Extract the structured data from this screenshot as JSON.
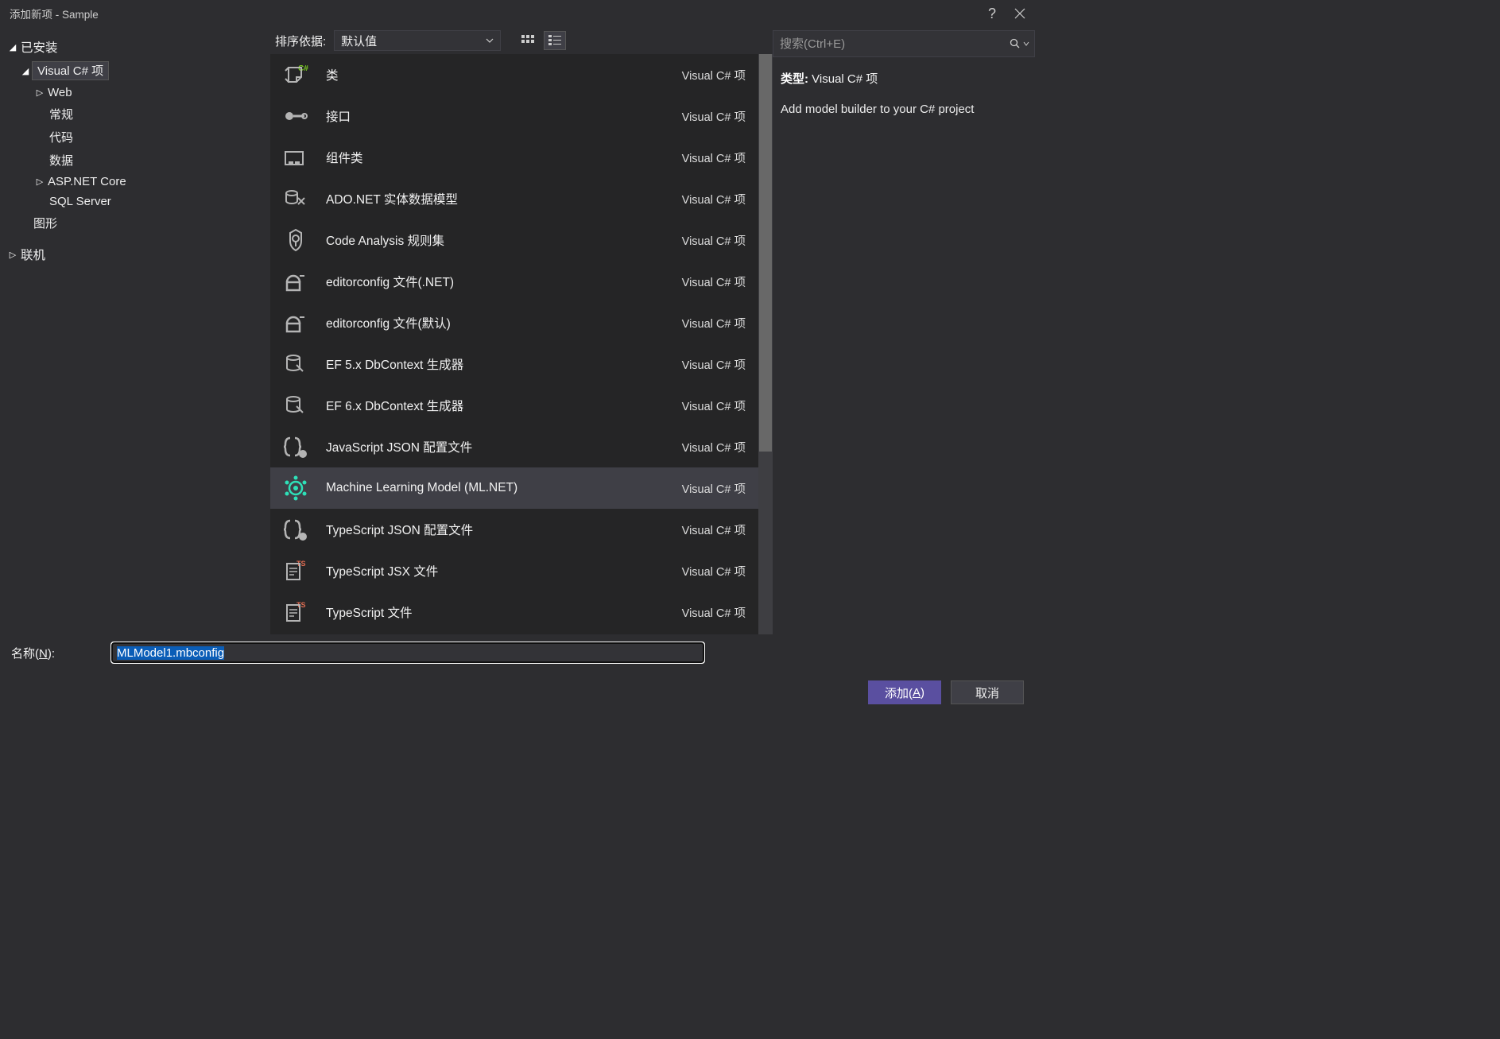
{
  "title": "添加新项 - Sample",
  "tree": {
    "installed": "已安装",
    "csharp": "Visual C# 项",
    "web": "Web",
    "general": "常规",
    "code": "代码",
    "data": "数据",
    "aspnet": "ASP.NET Core",
    "sqlserver": "SQL Server",
    "graphics": "图形",
    "online": "联机"
  },
  "sort": {
    "label": "排序依据:",
    "value": "默认值"
  },
  "search": {
    "placeholder": "搜索(Ctrl+E)"
  },
  "templates": [
    {
      "name": "类",
      "lang": "Visual C# 项"
    },
    {
      "name": "接口",
      "lang": "Visual C# 项"
    },
    {
      "name": "组件类",
      "lang": "Visual C# 项"
    },
    {
      "name": "ADO.NET 实体数据模型",
      "lang": "Visual C# 项"
    },
    {
      "name": "Code Analysis 规则集",
      "lang": "Visual C# 项"
    },
    {
      "name": "editorconfig 文件(.NET)",
      "lang": "Visual C# 项"
    },
    {
      "name": "editorconfig 文件(默认)",
      "lang": "Visual C# 项"
    },
    {
      "name": "EF 5.x DbContext 生成器",
      "lang": "Visual C# 项"
    },
    {
      "name": "EF 6.x DbContext 生成器",
      "lang": "Visual C# 项"
    },
    {
      "name": "JavaScript JSON 配置文件",
      "lang": "Visual C# 项"
    },
    {
      "name": "Machine Learning Model (ML.NET)",
      "lang": "Visual C# 项"
    },
    {
      "name": "TypeScript JSON 配置文件",
      "lang": "Visual C# 项"
    },
    {
      "name": "TypeScript JSX 文件",
      "lang": "Visual C# 项"
    },
    {
      "name": "TypeScript 文件",
      "lang": "Visual C# 项"
    }
  ],
  "selected_index": 10,
  "detail": {
    "type_label": "类型:",
    "type_value": "Visual C# 项",
    "description": "Add model builder to your C# project"
  },
  "name_field": {
    "label_prefix": "名称(",
    "label_key": "N",
    "label_suffix": "):",
    "value": "MLModel1.mbconfig"
  },
  "buttons": {
    "add_prefix": "添加(",
    "add_key": "A",
    "add_suffix": ")",
    "cancel": "取消"
  }
}
